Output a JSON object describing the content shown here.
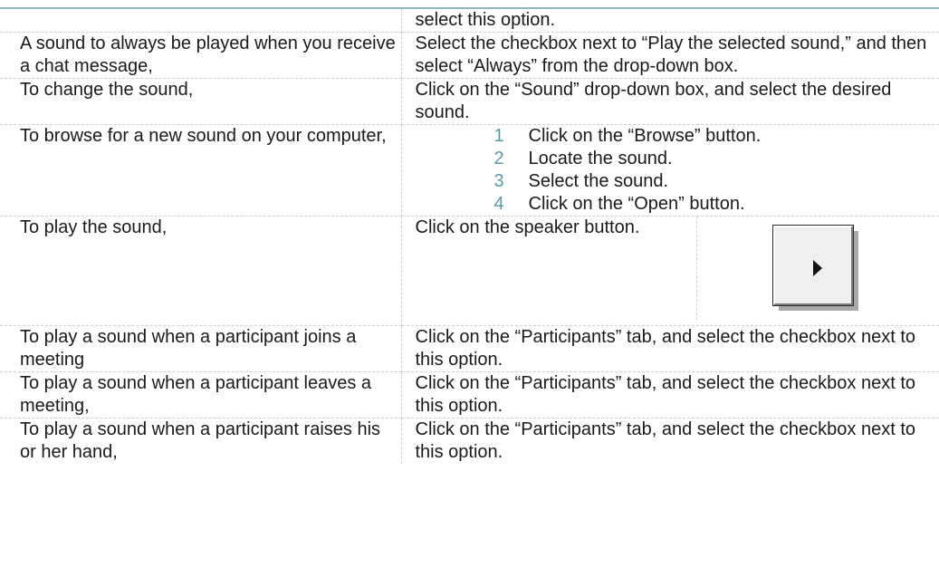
{
  "rows": [
    {
      "condition": "",
      "action": "select this option."
    },
    {
      "condition": "A sound to always be played when you receive a chat message,",
      "action": "Select the checkbox next to “Play the selected sound,” and then select “Always” from the drop-down box."
    },
    {
      "condition": "To change the sound,",
      "action": "Click on the “Sound” drop-down box, and select the desired sound."
    },
    {
      "condition": "To browse for a new sound on your computer,",
      "steps": [
        {
          "num": "1",
          "text": "Click on the “Browse” button."
        },
        {
          "num": "2",
          "text": "Locate the sound."
        },
        {
          "num": "3",
          "text": "Select the sound."
        },
        {
          "num": "4",
          "text": "Click on the “Open” button."
        }
      ]
    },
    {
      "condition": "To play the sound,",
      "action": "Click on the speaker button.",
      "button_icon": "play-icon"
    },
    {
      "condition": "To play a sound when a participant joins a meeting",
      "action": "Click on the “Participants” tab, and select the checkbox next to this option."
    },
    {
      "condition": "To play a sound when a participant leaves a meeting,",
      "action": "Click on the “Participants” tab, and select the checkbox next to this option."
    },
    {
      "condition": "To play a sound when a participant raises his or her hand,",
      "action": "Click on the “Participants” tab, and select the checkbox next to this option."
    }
  ],
  "colors": {
    "rule": "#8fb6bf",
    "step_number": "#5e9aa2",
    "divider": "#cfcfcf",
    "text": "#1a1a1a"
  }
}
